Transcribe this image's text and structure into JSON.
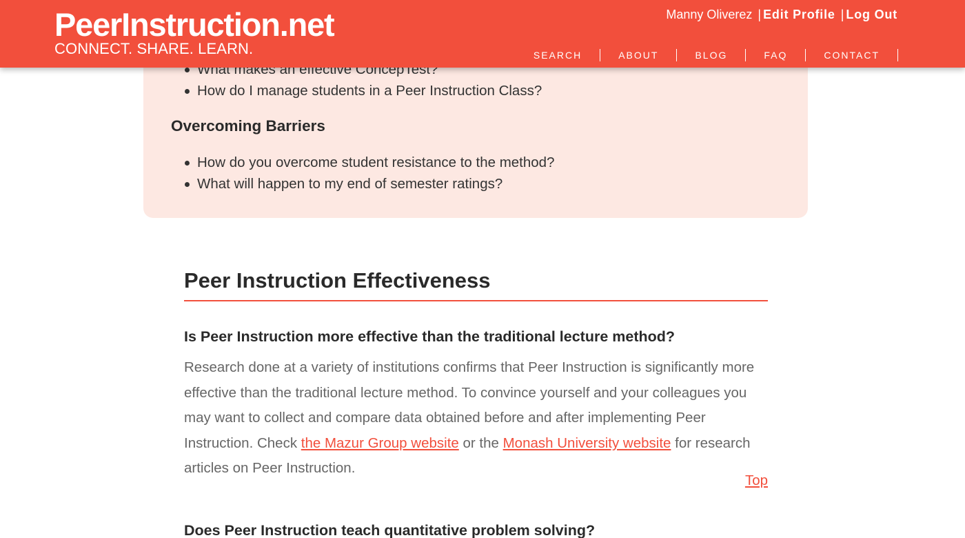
{
  "header": {
    "logo_title": "PeerInstruction.net",
    "logo_tagline": "CONNECT. SHARE. LEARN.",
    "user_name": "Manny Oliverez",
    "separator": "|",
    "edit_profile": "Edit Profile",
    "log_out": "Log Out",
    "nav": [
      "SEARCH",
      "ABOUT",
      "BLOG",
      "FAQ",
      "CONTACT"
    ]
  },
  "faq_box": {
    "list1": [
      "What makes an effective ConcepTest?",
      "How do I manage students in a Peer Instruction Class?"
    ],
    "heading": "Overcoming Barriers",
    "list2": [
      "How do you overcome student resistance to the method?",
      "What will happen to my end of semester ratings?"
    ]
  },
  "section": {
    "title": "Peer Instruction Effectiveness",
    "question1": "Is Peer Instruction more effective than the traditional lecture method?",
    "answer1_part1": "Research done at a variety of institutions confirms that Peer Instruction is significantly more effective than the traditional lecture method. To convince yourself and your colleagues you may want to collect and compare data obtained before and after implementing Peer Instruction. Check ",
    "link1": "the Mazur Group website",
    "answer1_part2": " or the ",
    "link2": "Monash University website",
    "answer1_part3": " for research articles on Peer Instruction.",
    "top_link": "Top",
    "question2": "Does Peer Instruction teach quantitative problem solving?"
  },
  "colors": {
    "brand": "#f24f3c",
    "faq_background": "#fde8e2",
    "body_text": "#666666",
    "heading_text": "#2a2a2a"
  }
}
